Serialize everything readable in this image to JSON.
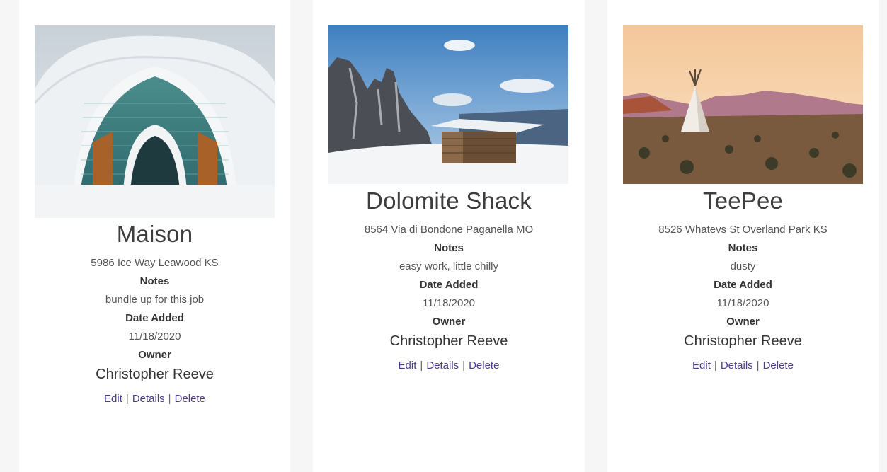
{
  "cards": [
    {
      "title": "Maison",
      "address": "5986 Ice Way Leawood KS",
      "notes_label": "Notes",
      "notes": "bundle up for this job",
      "date_label": "Date Added",
      "date": "11/18/2020",
      "owner_label": "Owner",
      "owner": "Christopher Reeve",
      "actions": {
        "edit": "Edit",
        "details": "Details",
        "delete": "Delete",
        "separator": "|"
      }
    },
    {
      "title": "Dolomite Shack",
      "address": "8564 Via di Bondone Paganella MO",
      "notes_label": "Notes",
      "notes": "easy work, little chilly",
      "date_label": "Date Added",
      "date": "11/18/2020",
      "owner_label": "Owner",
      "owner": "Christopher Reeve",
      "actions": {
        "edit": "Edit",
        "details": "Details",
        "delete": "Delete",
        "separator": "|"
      }
    },
    {
      "title": "TeePee",
      "address": "8526 Whatevs St Overland Park KS",
      "notes_label": "Notes",
      "notes": "dusty",
      "date_label": "Date Added",
      "date": "11/18/2020",
      "owner_label": "Owner",
      "owner": "Christopher Reeve",
      "actions": {
        "edit": "Edit",
        "details": "Details",
        "delete": "Delete",
        "separator": "|"
      }
    }
  ],
  "colors": {
    "link": "#4b3b8a",
    "page_background": "#f6f6f6",
    "card_background": "#ffffff"
  }
}
